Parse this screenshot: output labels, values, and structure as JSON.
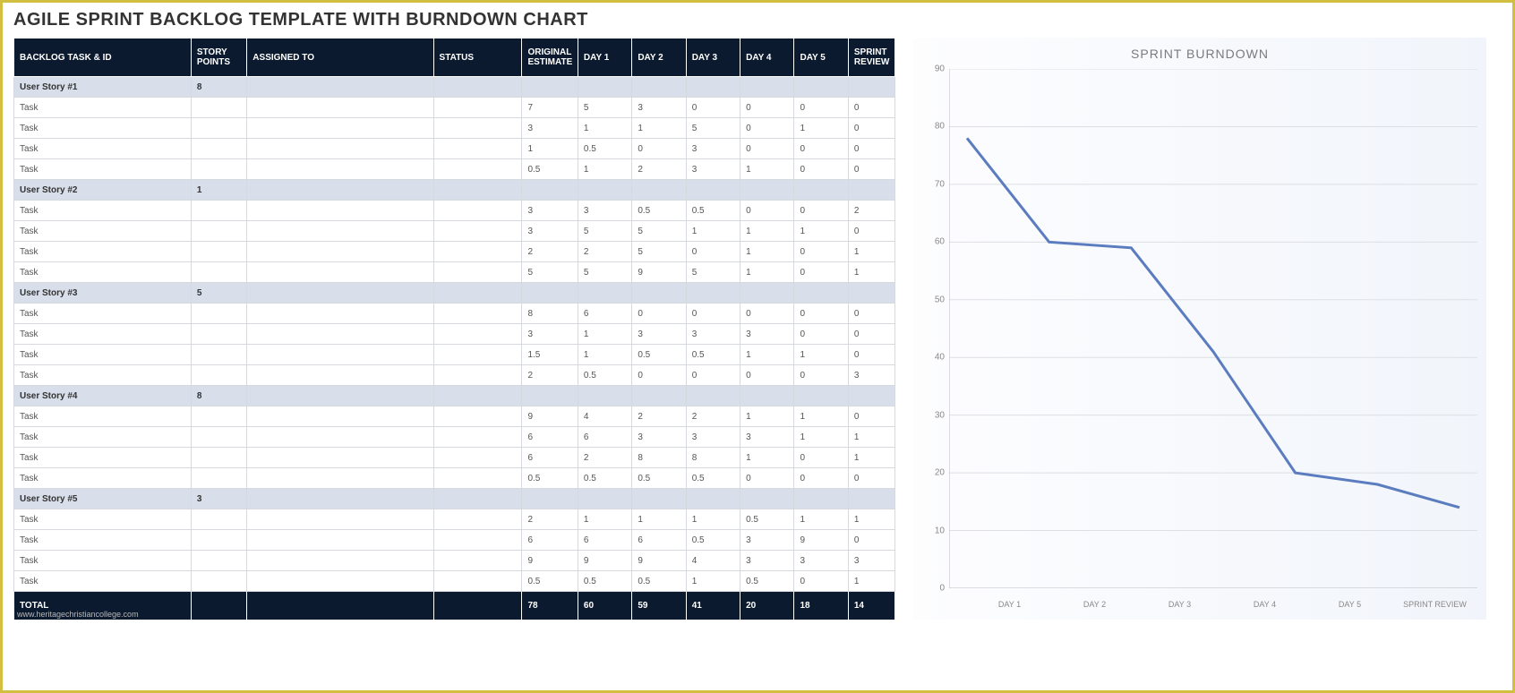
{
  "title": "AGILE SPRINT BACKLOG TEMPLATE WITH BURNDOWN CHART",
  "watermark": "www.heritagechristiancollege.com",
  "columns": {
    "task": "BACKLOG TASK & ID",
    "points": "STORY POINTS",
    "assigned": "ASSIGNED TO",
    "status": "STATUS",
    "estimate": "ORIGINAL ESTIMATE",
    "day1": "DAY 1",
    "day2": "DAY 2",
    "day3": "DAY 3",
    "day4": "DAY 4",
    "day5": "DAY 5",
    "review": "SPRINT REVIEW"
  },
  "rows": [
    {
      "type": "story",
      "task": "User Story #1",
      "points": "8"
    },
    {
      "type": "task",
      "task": "Task",
      "estimate": "7",
      "day1": "5",
      "day2": "3",
      "day3": "0",
      "day4": "0",
      "day5": "0",
      "review": "0"
    },
    {
      "type": "task",
      "task": "Task",
      "estimate": "3",
      "day1": "1",
      "day2": "1",
      "day3": "5",
      "day4": "0",
      "day5": "1",
      "review": "0"
    },
    {
      "type": "task",
      "task": "Task",
      "estimate": "1",
      "day1": "0.5",
      "day2": "0",
      "day3": "3",
      "day4": "0",
      "day5": "0",
      "review": "0"
    },
    {
      "type": "task",
      "task": "Task",
      "estimate": "0.5",
      "day1": "1",
      "day2": "2",
      "day3": "3",
      "day4": "1",
      "day5": "0",
      "review": "0"
    },
    {
      "type": "story",
      "task": "User Story #2",
      "points": "1"
    },
    {
      "type": "task",
      "task": "Task",
      "estimate": "3",
      "day1": "3",
      "day2": "0.5",
      "day3": "0.5",
      "day4": "0",
      "day5": "0",
      "review": "2"
    },
    {
      "type": "task",
      "task": "Task",
      "estimate": "3",
      "day1": "5",
      "day2": "5",
      "day3": "1",
      "day4": "1",
      "day5": "1",
      "review": "0"
    },
    {
      "type": "task",
      "task": "Task",
      "estimate": "2",
      "day1": "2",
      "day2": "5",
      "day3": "0",
      "day4": "1",
      "day5": "0",
      "review": "1"
    },
    {
      "type": "task",
      "task": "Task",
      "estimate": "5",
      "day1": "5",
      "day2": "9",
      "day3": "5",
      "day4": "1",
      "day5": "0",
      "review": "1"
    },
    {
      "type": "story",
      "task": "User Story #3",
      "points": "5"
    },
    {
      "type": "task",
      "task": "Task",
      "estimate": "8",
      "day1": "6",
      "day2": "0",
      "day3": "0",
      "day4": "0",
      "day5": "0",
      "review": "0"
    },
    {
      "type": "task",
      "task": "Task",
      "estimate": "3",
      "day1": "1",
      "day2": "3",
      "day3": "3",
      "day4": "3",
      "day5": "0",
      "review": "0"
    },
    {
      "type": "task",
      "task": "Task",
      "estimate": "1.5",
      "day1": "1",
      "day2": "0.5",
      "day3": "0.5",
      "day4": "1",
      "day5": "1",
      "review": "0"
    },
    {
      "type": "task",
      "task": "Task",
      "estimate": "2",
      "day1": "0.5",
      "day2": "0",
      "day3": "0",
      "day4": "0",
      "day5": "0",
      "review": "3"
    },
    {
      "type": "story",
      "task": "User Story #4",
      "points": "8"
    },
    {
      "type": "task",
      "task": "Task",
      "estimate": "9",
      "day1": "4",
      "day2": "2",
      "day3": "2",
      "day4": "1",
      "day5": "1",
      "review": "0"
    },
    {
      "type": "task",
      "task": "Task",
      "estimate": "6",
      "day1": "6",
      "day2": "3",
      "day3": "3",
      "day4": "3",
      "day5": "1",
      "review": "1"
    },
    {
      "type": "task",
      "task": "Task",
      "estimate": "6",
      "day1": "2",
      "day2": "8",
      "day3": "8",
      "day4": "1",
      "day5": "0",
      "review": "1"
    },
    {
      "type": "task",
      "task": "Task",
      "estimate": "0.5",
      "day1": "0.5",
      "day2": "0.5",
      "day3": "0.5",
      "day4": "0",
      "day5": "0",
      "review": "0"
    },
    {
      "type": "story",
      "task": "User Story #5",
      "points": "3"
    },
    {
      "type": "task",
      "task": "Task",
      "estimate": "2",
      "day1": "1",
      "day2": "1",
      "day3": "1",
      "day4": "0.5",
      "day5": "1",
      "review": "1"
    },
    {
      "type": "task",
      "task": "Task",
      "estimate": "6",
      "day1": "6",
      "day2": "6",
      "day3": "0.5",
      "day4": "3",
      "day5": "9",
      "review": "0"
    },
    {
      "type": "task",
      "task": "Task",
      "estimate": "9",
      "day1": "9",
      "day2": "9",
      "day3": "4",
      "day4": "3",
      "day5": "3",
      "review": "3"
    },
    {
      "type": "task",
      "task": "Task",
      "estimate": "0.5",
      "day1": "0.5",
      "day2": "0.5",
      "day3": "1",
      "day4": "0.5",
      "day5": "0",
      "review": "1"
    }
  ],
  "totals": {
    "label": "TOTAL",
    "estimate": "78",
    "day1": "60",
    "day2": "59",
    "day3": "41",
    "day4": "20",
    "day5": "18",
    "review": "14"
  },
  "chart_data": {
    "type": "line",
    "title": "SPRINT BURNDOWN",
    "categories": [
      "DAY 1",
      "DAY 2",
      "DAY 3",
      "DAY 4",
      "DAY 5",
      "SPRINT REVIEW"
    ],
    "values": [
      78,
      60,
      59,
      41,
      20,
      18,
      14
    ],
    "ylim": [
      0,
      90
    ],
    "yticks": [
      0,
      10,
      20,
      30,
      40,
      50,
      60,
      70,
      80,
      90
    ],
    "xlabel": "",
    "ylabel": ""
  }
}
